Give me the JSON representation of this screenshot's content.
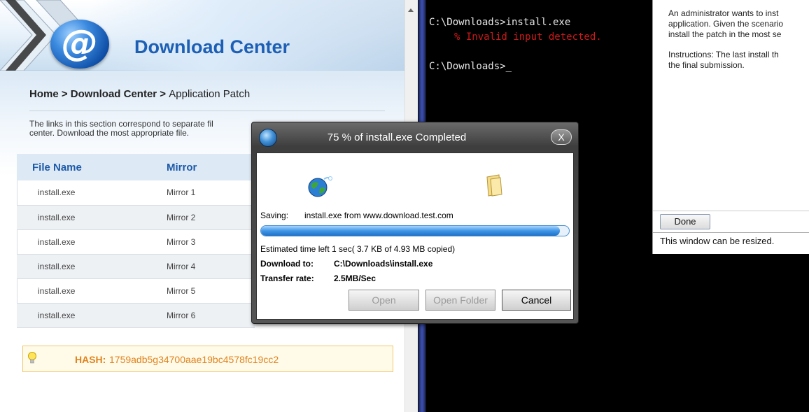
{
  "browser": {
    "banner_title": "Download Center",
    "logo_text": "@",
    "breadcrumb": {
      "home": "Home",
      "sep1": " > ",
      "download_center": "Download Center",
      "sep2": " > ",
      "current": "Application Patch"
    },
    "intro_line1": "The links in this section correspond to separate fil",
    "intro_line2": "center. Download the most appropriate file.",
    "table": {
      "headers": [
        "File Name",
        "Mirror"
      ],
      "rows": [
        {
          "file": "install.exe",
          "mirror": "Mirror 1"
        },
        {
          "file": "install.exe",
          "mirror": "Mirror 2"
        },
        {
          "file": "install.exe",
          "mirror": "Mirror 3"
        },
        {
          "file": "install.exe",
          "mirror": "Mirror 4"
        },
        {
          "file": "install.exe",
          "mirror": "Mirror 5"
        },
        {
          "file": "install.exe",
          "mirror": "Mirror 6"
        }
      ]
    },
    "hash_label": "HASH:",
    "hash_value": "1759adb5g34700aae19bc4578fc19cc2"
  },
  "terminal": {
    "line1": "C:\\Downloads>install.exe",
    "line2": "% Invalid input detected.",
    "line3": "C:\\Downloads>",
    "cursor": "_"
  },
  "instructions": {
    "para1": "An administrator wants to inst\napplication. Given the scenario\ninstall the patch in the most se",
    "para2": "Instructions: The last install th\nthe final submission.",
    "done_label": "Done",
    "resize_note": "This window can be resized."
  },
  "dialog": {
    "title": "75 % of install.exe Completed",
    "close_label": "X",
    "saving_label": "Saving:",
    "saving_value": "install.exe from www.download.test.com",
    "progress_fraction": 0.97,
    "eta": "Estimated time left 1 sec( 3.7 KB of 4.93 MB copied)",
    "download_to_label": "Download to:",
    "download_to_value": "C:\\Downloads\\install.exe",
    "transfer_rate_label": "Transfer rate:",
    "transfer_rate_value": "2.5MB/Sec",
    "buttons": {
      "open": "Open",
      "open_folder": "Open Folder",
      "cancel": "Cancel"
    }
  },
  "colors": {
    "brand_blue": "#1c5fb5",
    "hash_orange": "#e0821e",
    "terminal_error": "#d01818"
  }
}
